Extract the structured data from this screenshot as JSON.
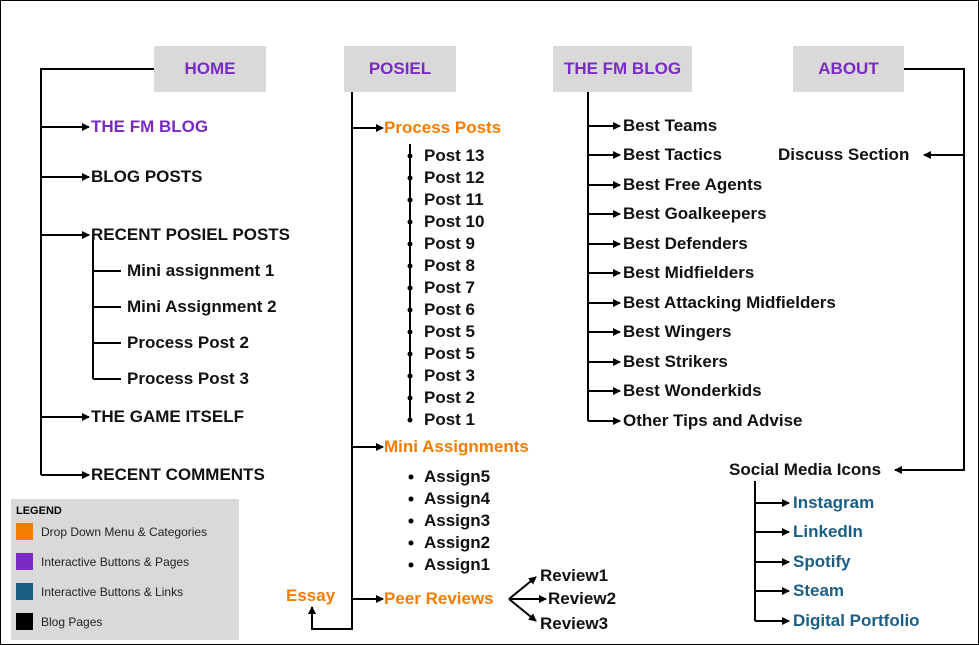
{
  "nav": {
    "home": "HOME",
    "posiel": "POSIEL",
    "fm_blog": "THE FM BLOG",
    "about": "ABOUT"
  },
  "home_items": [
    "THE FM BLOG",
    "BLOG POSTS",
    "RECENT POSIEL POSTS",
    "THE GAME ITSELF",
    "RECENT COMMENTS"
  ],
  "recent_posiel_posts": [
    "Mini assignment 1",
    "Mini Assignment 2",
    "Process Post 2",
    "Process Post 3"
  ],
  "posiel": {
    "process_posts": "Process Posts",
    "posts": [
      "Post 13",
      "Post 12",
      "Post 11",
      "Post 10",
      "Post 9",
      "Post 8",
      "Post 7",
      "Post 6",
      "Post 5",
      "Post 5",
      "Post 3",
      "Post 2",
      "Post 1"
    ],
    "mini_assignments": "Mini Assignments",
    "assigns": [
      "Assign5",
      "Assign4",
      "Assign3",
      "Assign2",
      "Assign1"
    ],
    "peer_reviews": "Peer Reviews",
    "reviews": [
      "Review1",
      "Review2",
      "Review3"
    ],
    "essay": "Essay"
  },
  "fm_blog_items": [
    "Best Teams",
    "Best Tactics",
    "Best Free Agents",
    "Best Goalkeepers",
    "Best Defenders",
    "Best Midfielders",
    "Best Attacking Midfielders",
    "Best Wingers",
    "Best Strikers",
    "Best Wonderkids",
    "Other Tips and Advise"
  ],
  "about": {
    "discuss": "Discuss Section",
    "social": "Social Media Icons",
    "links": [
      "Instagram",
      "LinkedIn",
      "Spotify",
      "Steam",
      "Digital Portfolio"
    ]
  },
  "legend": {
    "title": "LEGEND",
    "items": [
      {
        "label": "Drop Down Menu & Categories",
        "color": "#f57c00"
      },
      {
        "label": "Interactive Buttons & Pages",
        "color": "#7b2ac4"
      },
      {
        "label": "Interactive Buttons & Links",
        "color": "#1b5e85"
      },
      {
        "label": "Blog Pages",
        "color": "#000000"
      }
    ]
  }
}
